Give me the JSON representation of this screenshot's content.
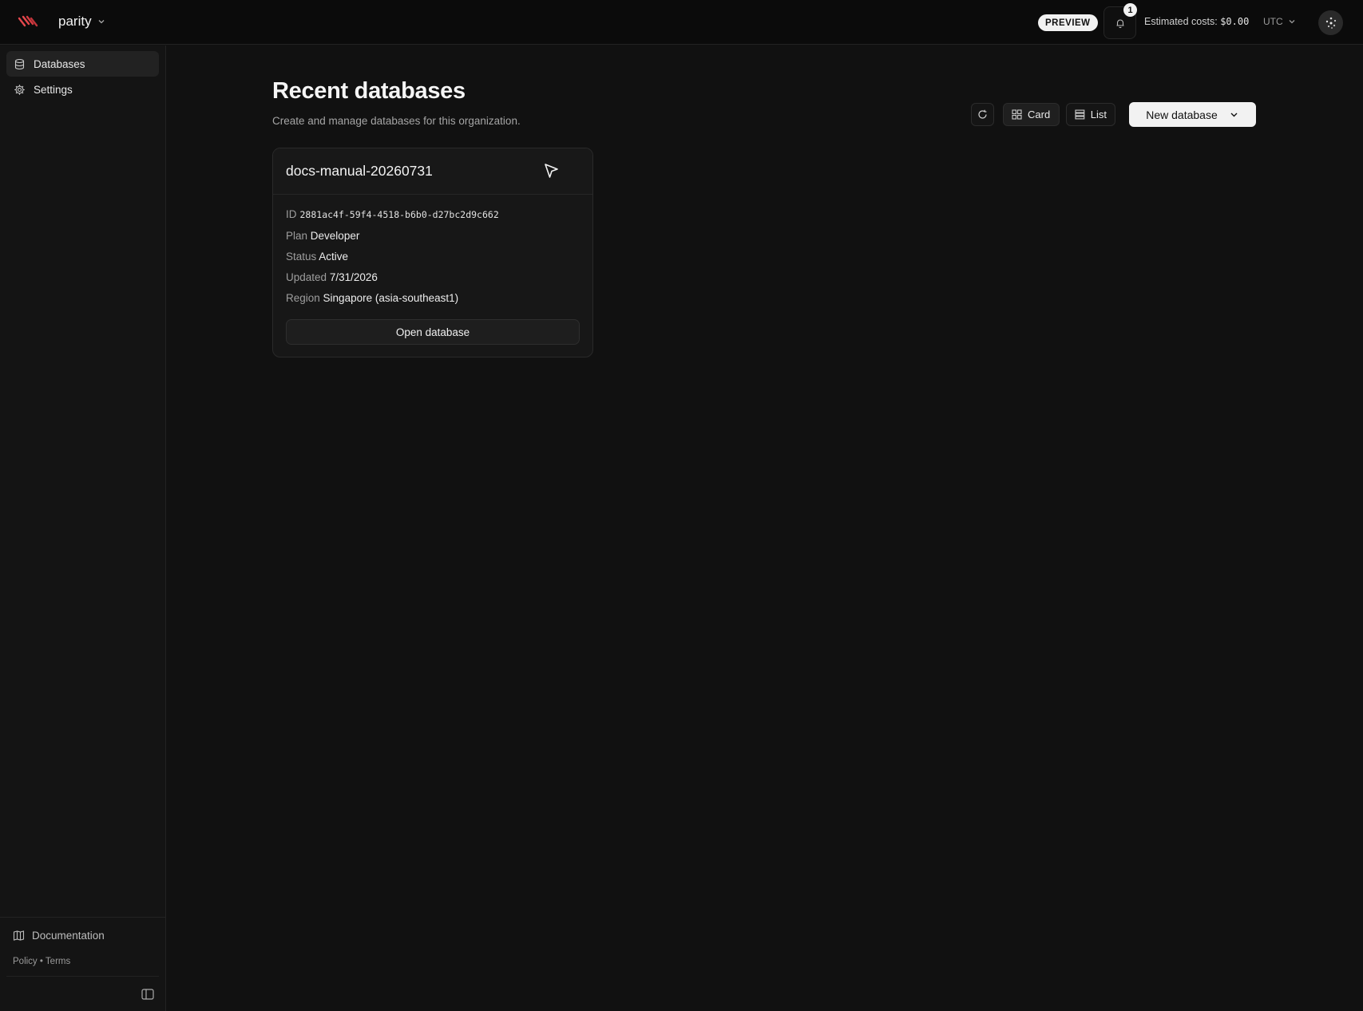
{
  "header": {
    "org_name": "parity",
    "preview_badge": "PREVIEW",
    "notification_count": "1",
    "costs_label": "Estimated costs:",
    "costs_value": "$0.00",
    "timezone": "UTC"
  },
  "sidebar": {
    "items": [
      {
        "label": "Databases",
        "icon": "database-icon",
        "active": true
      },
      {
        "label": "Settings",
        "icon": "gear-icon",
        "active": false
      }
    ],
    "documentation": "Documentation",
    "policy": "Policy",
    "separator": "•",
    "terms": "Terms"
  },
  "main": {
    "title": "Recent databases",
    "subtitle": "Create and manage databases for this organization.",
    "view_card_label": "Card",
    "view_list_label": "List",
    "new_database_label": "New database"
  },
  "database": {
    "name": "docs-manual-20260731",
    "id_label": "ID",
    "id_value": "2881ac4f-59f4-4518-b6b0-d27bc2d9c662",
    "plan_label": "Plan",
    "plan_value": "Developer",
    "status_label": "Status",
    "status_value": "Active",
    "updated_label": "Updated",
    "updated_value": "7/31/2026",
    "region_label": "Region",
    "region_value": "Singapore (asia-southeast1)",
    "open_label": "Open database"
  },
  "colors": {
    "background": "#111111",
    "sidebar": "#141414",
    "logo_accent": "#e5484d",
    "primary_button": "#f2f2f2"
  }
}
